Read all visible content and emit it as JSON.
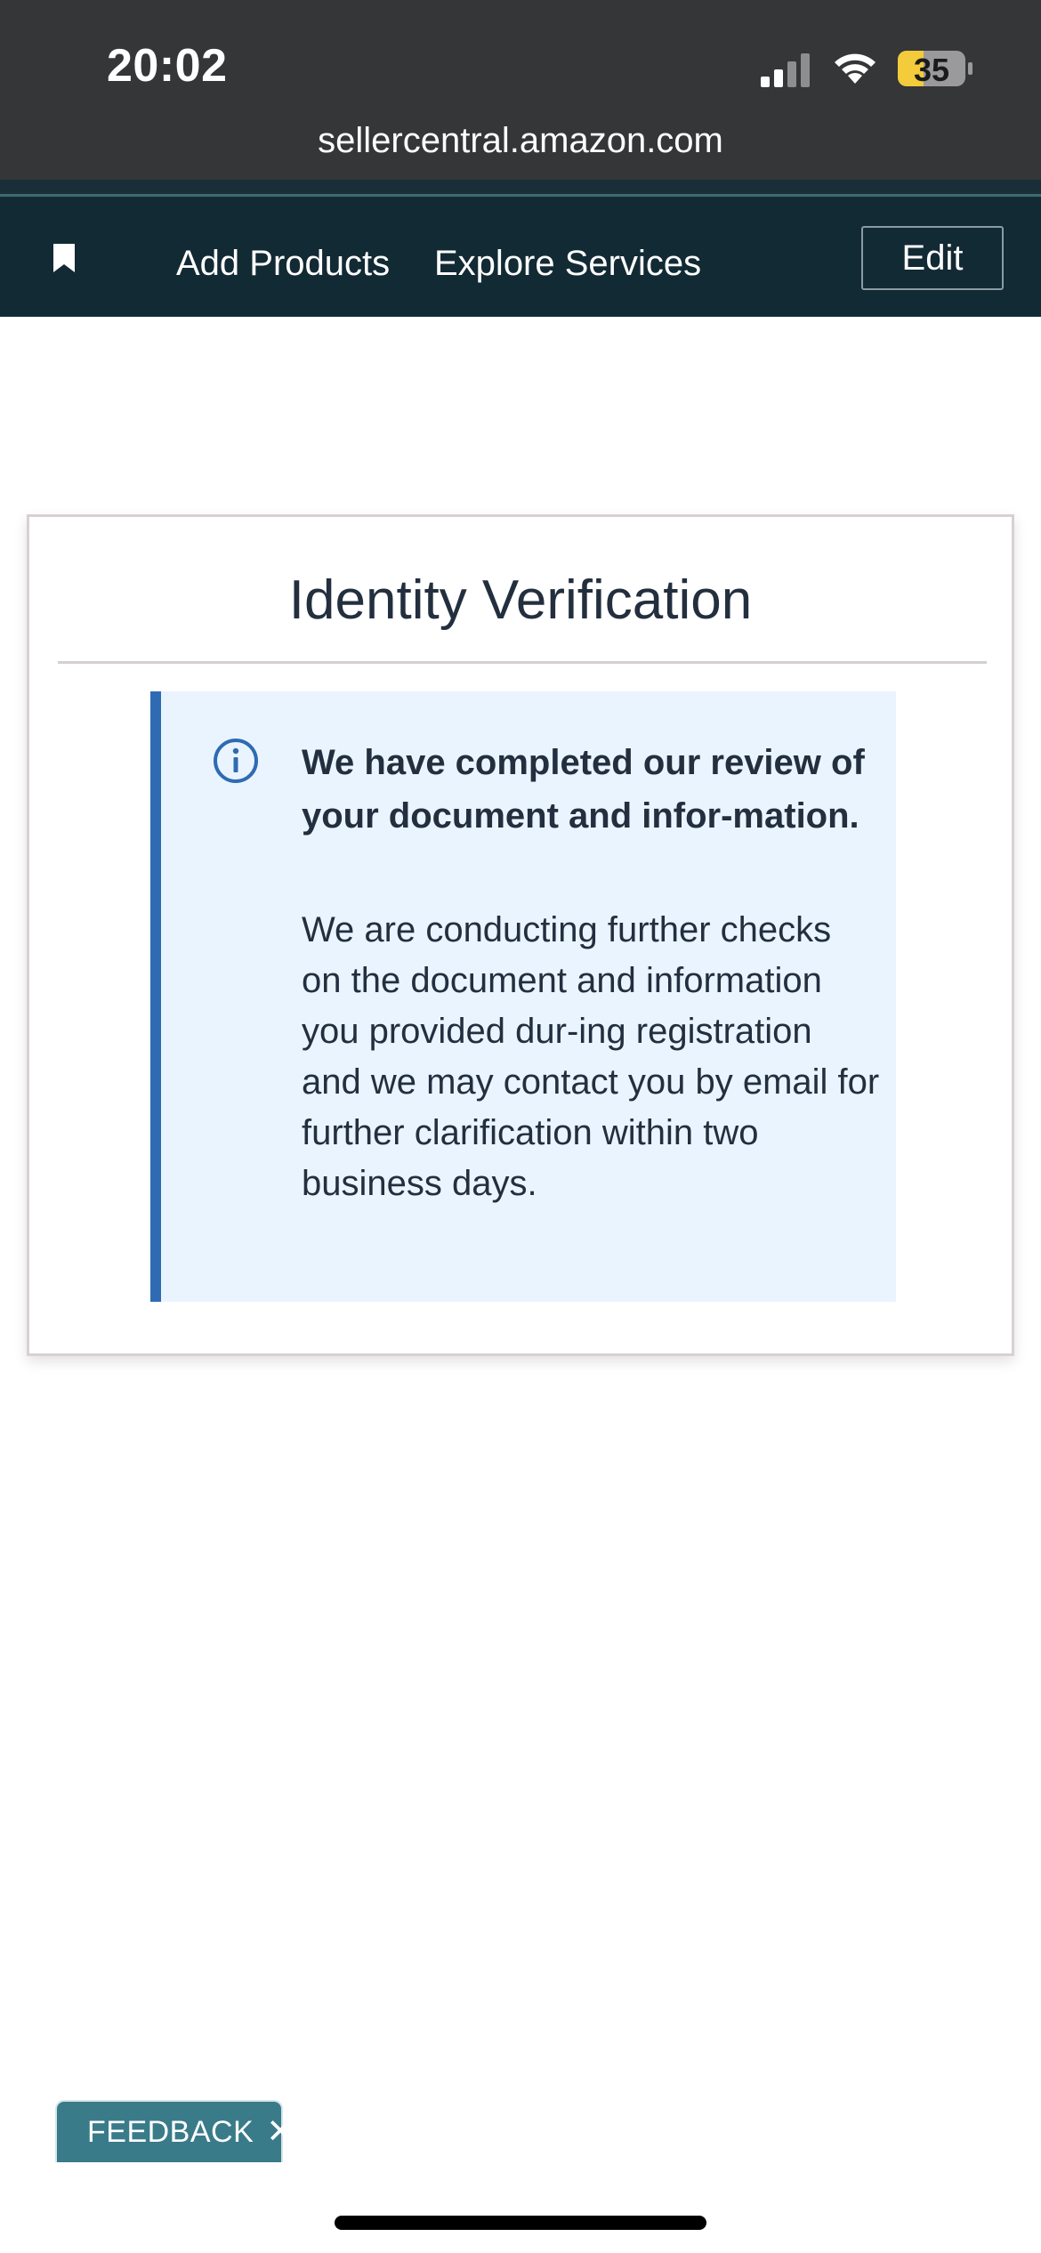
{
  "status_bar": {
    "time": "20:02",
    "battery": "35",
    "signal_icon": "cellular-signal-icon",
    "wifi_icon": "wifi-icon",
    "battery_icon": "battery-icon"
  },
  "browser": {
    "url": "sellercentral.amazon.com"
  },
  "nav": {
    "bookmark_icon": "bookmark-icon",
    "links": [
      "Add Products",
      "Explore Services"
    ],
    "edit_label": "Edit"
  },
  "card": {
    "title": "Identity Verification",
    "alert": {
      "icon": "info-icon",
      "heading": "We have completed our review of your document and infor-mation.",
      "body": "We are conducting further checks on the document and information you provided dur-ing registration and we may contact you by email for further clarification within two business days."
    }
  },
  "feedback": {
    "label": "FEEDBACK",
    "close": "✕"
  },
  "colors": {
    "status_bg": "#353638",
    "nav_bg": "#122a34",
    "alert_bg": "#eaf4ff",
    "alert_accent": "#2f6bb3",
    "feedback_bg": "#3a7b8a",
    "text_dark": "#232f3e"
  }
}
